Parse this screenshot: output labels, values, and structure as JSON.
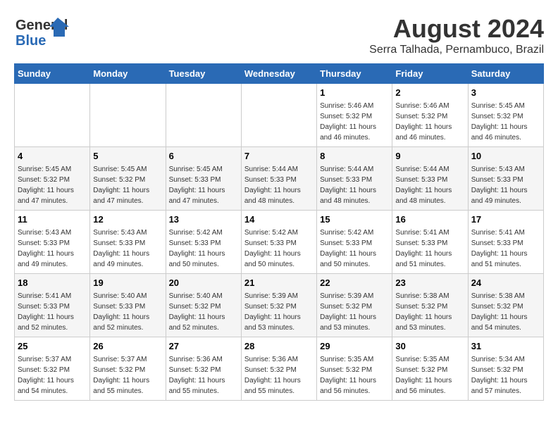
{
  "header": {
    "logo_general": "General",
    "logo_blue": "Blue",
    "title": "August 2024",
    "subtitle": "Serra Talhada, Pernambuco, Brazil"
  },
  "columns": [
    "Sunday",
    "Monday",
    "Tuesday",
    "Wednesday",
    "Thursday",
    "Friday",
    "Saturday"
  ],
  "weeks": [
    [
      {
        "day": "",
        "info": ""
      },
      {
        "day": "",
        "info": ""
      },
      {
        "day": "",
        "info": ""
      },
      {
        "day": "",
        "info": ""
      },
      {
        "day": "1",
        "info": "Sunrise: 5:46 AM\nSunset: 5:32 PM\nDaylight: 11 hours\nand 46 minutes."
      },
      {
        "day": "2",
        "info": "Sunrise: 5:46 AM\nSunset: 5:32 PM\nDaylight: 11 hours\nand 46 minutes."
      },
      {
        "day": "3",
        "info": "Sunrise: 5:45 AM\nSunset: 5:32 PM\nDaylight: 11 hours\nand 46 minutes."
      }
    ],
    [
      {
        "day": "4",
        "info": "Sunrise: 5:45 AM\nSunset: 5:32 PM\nDaylight: 11 hours\nand 47 minutes."
      },
      {
        "day": "5",
        "info": "Sunrise: 5:45 AM\nSunset: 5:32 PM\nDaylight: 11 hours\nand 47 minutes."
      },
      {
        "day": "6",
        "info": "Sunrise: 5:45 AM\nSunset: 5:33 PM\nDaylight: 11 hours\nand 47 minutes."
      },
      {
        "day": "7",
        "info": "Sunrise: 5:44 AM\nSunset: 5:33 PM\nDaylight: 11 hours\nand 48 minutes."
      },
      {
        "day": "8",
        "info": "Sunrise: 5:44 AM\nSunset: 5:33 PM\nDaylight: 11 hours\nand 48 minutes."
      },
      {
        "day": "9",
        "info": "Sunrise: 5:44 AM\nSunset: 5:33 PM\nDaylight: 11 hours\nand 48 minutes."
      },
      {
        "day": "10",
        "info": "Sunrise: 5:43 AM\nSunset: 5:33 PM\nDaylight: 11 hours\nand 49 minutes."
      }
    ],
    [
      {
        "day": "11",
        "info": "Sunrise: 5:43 AM\nSunset: 5:33 PM\nDaylight: 11 hours\nand 49 minutes."
      },
      {
        "day": "12",
        "info": "Sunrise: 5:43 AM\nSunset: 5:33 PM\nDaylight: 11 hours\nand 49 minutes."
      },
      {
        "day": "13",
        "info": "Sunrise: 5:42 AM\nSunset: 5:33 PM\nDaylight: 11 hours\nand 50 minutes."
      },
      {
        "day": "14",
        "info": "Sunrise: 5:42 AM\nSunset: 5:33 PM\nDaylight: 11 hours\nand 50 minutes."
      },
      {
        "day": "15",
        "info": "Sunrise: 5:42 AM\nSunset: 5:33 PM\nDaylight: 11 hours\nand 50 minutes."
      },
      {
        "day": "16",
        "info": "Sunrise: 5:41 AM\nSunset: 5:33 PM\nDaylight: 11 hours\nand 51 minutes."
      },
      {
        "day": "17",
        "info": "Sunrise: 5:41 AM\nSunset: 5:33 PM\nDaylight: 11 hours\nand 51 minutes."
      }
    ],
    [
      {
        "day": "18",
        "info": "Sunrise: 5:41 AM\nSunset: 5:33 PM\nDaylight: 11 hours\nand 52 minutes."
      },
      {
        "day": "19",
        "info": "Sunrise: 5:40 AM\nSunset: 5:33 PM\nDaylight: 11 hours\nand 52 minutes."
      },
      {
        "day": "20",
        "info": "Sunrise: 5:40 AM\nSunset: 5:32 PM\nDaylight: 11 hours\nand 52 minutes."
      },
      {
        "day": "21",
        "info": "Sunrise: 5:39 AM\nSunset: 5:32 PM\nDaylight: 11 hours\nand 53 minutes."
      },
      {
        "day": "22",
        "info": "Sunrise: 5:39 AM\nSunset: 5:32 PM\nDaylight: 11 hours\nand 53 minutes."
      },
      {
        "day": "23",
        "info": "Sunrise: 5:38 AM\nSunset: 5:32 PM\nDaylight: 11 hours\nand 53 minutes."
      },
      {
        "day": "24",
        "info": "Sunrise: 5:38 AM\nSunset: 5:32 PM\nDaylight: 11 hours\nand 54 minutes."
      }
    ],
    [
      {
        "day": "25",
        "info": "Sunrise: 5:37 AM\nSunset: 5:32 PM\nDaylight: 11 hours\nand 54 minutes."
      },
      {
        "day": "26",
        "info": "Sunrise: 5:37 AM\nSunset: 5:32 PM\nDaylight: 11 hours\nand 55 minutes."
      },
      {
        "day": "27",
        "info": "Sunrise: 5:36 AM\nSunset: 5:32 PM\nDaylight: 11 hours\nand 55 minutes."
      },
      {
        "day": "28",
        "info": "Sunrise: 5:36 AM\nSunset: 5:32 PM\nDaylight: 11 hours\nand 55 minutes."
      },
      {
        "day": "29",
        "info": "Sunrise: 5:35 AM\nSunset: 5:32 PM\nDaylight: 11 hours\nand 56 minutes."
      },
      {
        "day": "30",
        "info": "Sunrise: 5:35 AM\nSunset: 5:32 PM\nDaylight: 11 hours\nand 56 minutes."
      },
      {
        "day": "31",
        "info": "Sunrise: 5:34 AM\nSunset: 5:32 PM\nDaylight: 11 hours\nand 57 minutes."
      }
    ]
  ]
}
